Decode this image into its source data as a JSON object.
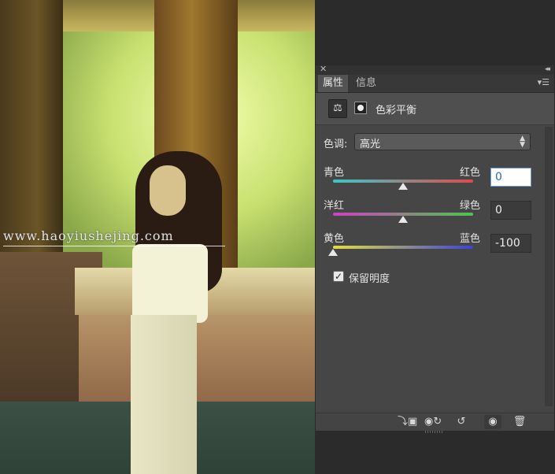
{
  "photo": {
    "watermark": "www.haoyiushejing.com"
  },
  "panel": {
    "close_icon": "close-icon",
    "collapse_icon": "collapse-icon",
    "tabs": [
      {
        "label": "属性",
        "active": true
      },
      {
        "label": "信息",
        "active": false
      }
    ],
    "menu_icon": "panel-menu-icon",
    "header": {
      "title": "色彩平衡",
      "icon1": "balance-scale-icon",
      "icon2": "layer-mask-icon"
    },
    "tone": {
      "label": "色调:",
      "value": "高光"
    },
    "sliders": [
      {
        "left_label": "青色",
        "right_label": "红色",
        "value": "0",
        "position": 0.5
      },
      {
        "left_label": "洋红",
        "right_label": "绿色",
        "value": "0",
        "position": 0.5
      },
      {
        "left_label": "黄色",
        "right_label": "蓝色",
        "value": "-100",
        "position": 0.0
      }
    ],
    "preserve_luminosity": {
      "label": "保留明度",
      "checked": true
    },
    "bottom_icons": [
      "clip-to-layer-icon",
      "view-previous-state-icon",
      "reset-icon",
      "visibility-icon",
      "delete-icon"
    ]
  },
  "colors": {
    "panel_bg": "#464646",
    "track_cyan_red": [
      "#3cc7c7",
      "#e04a4a"
    ],
    "track_magenta_green": [
      "#d040c0",
      "#4cc64c"
    ],
    "track_yellow_blue": [
      "#e0e040",
      "#4040d8"
    ]
  }
}
